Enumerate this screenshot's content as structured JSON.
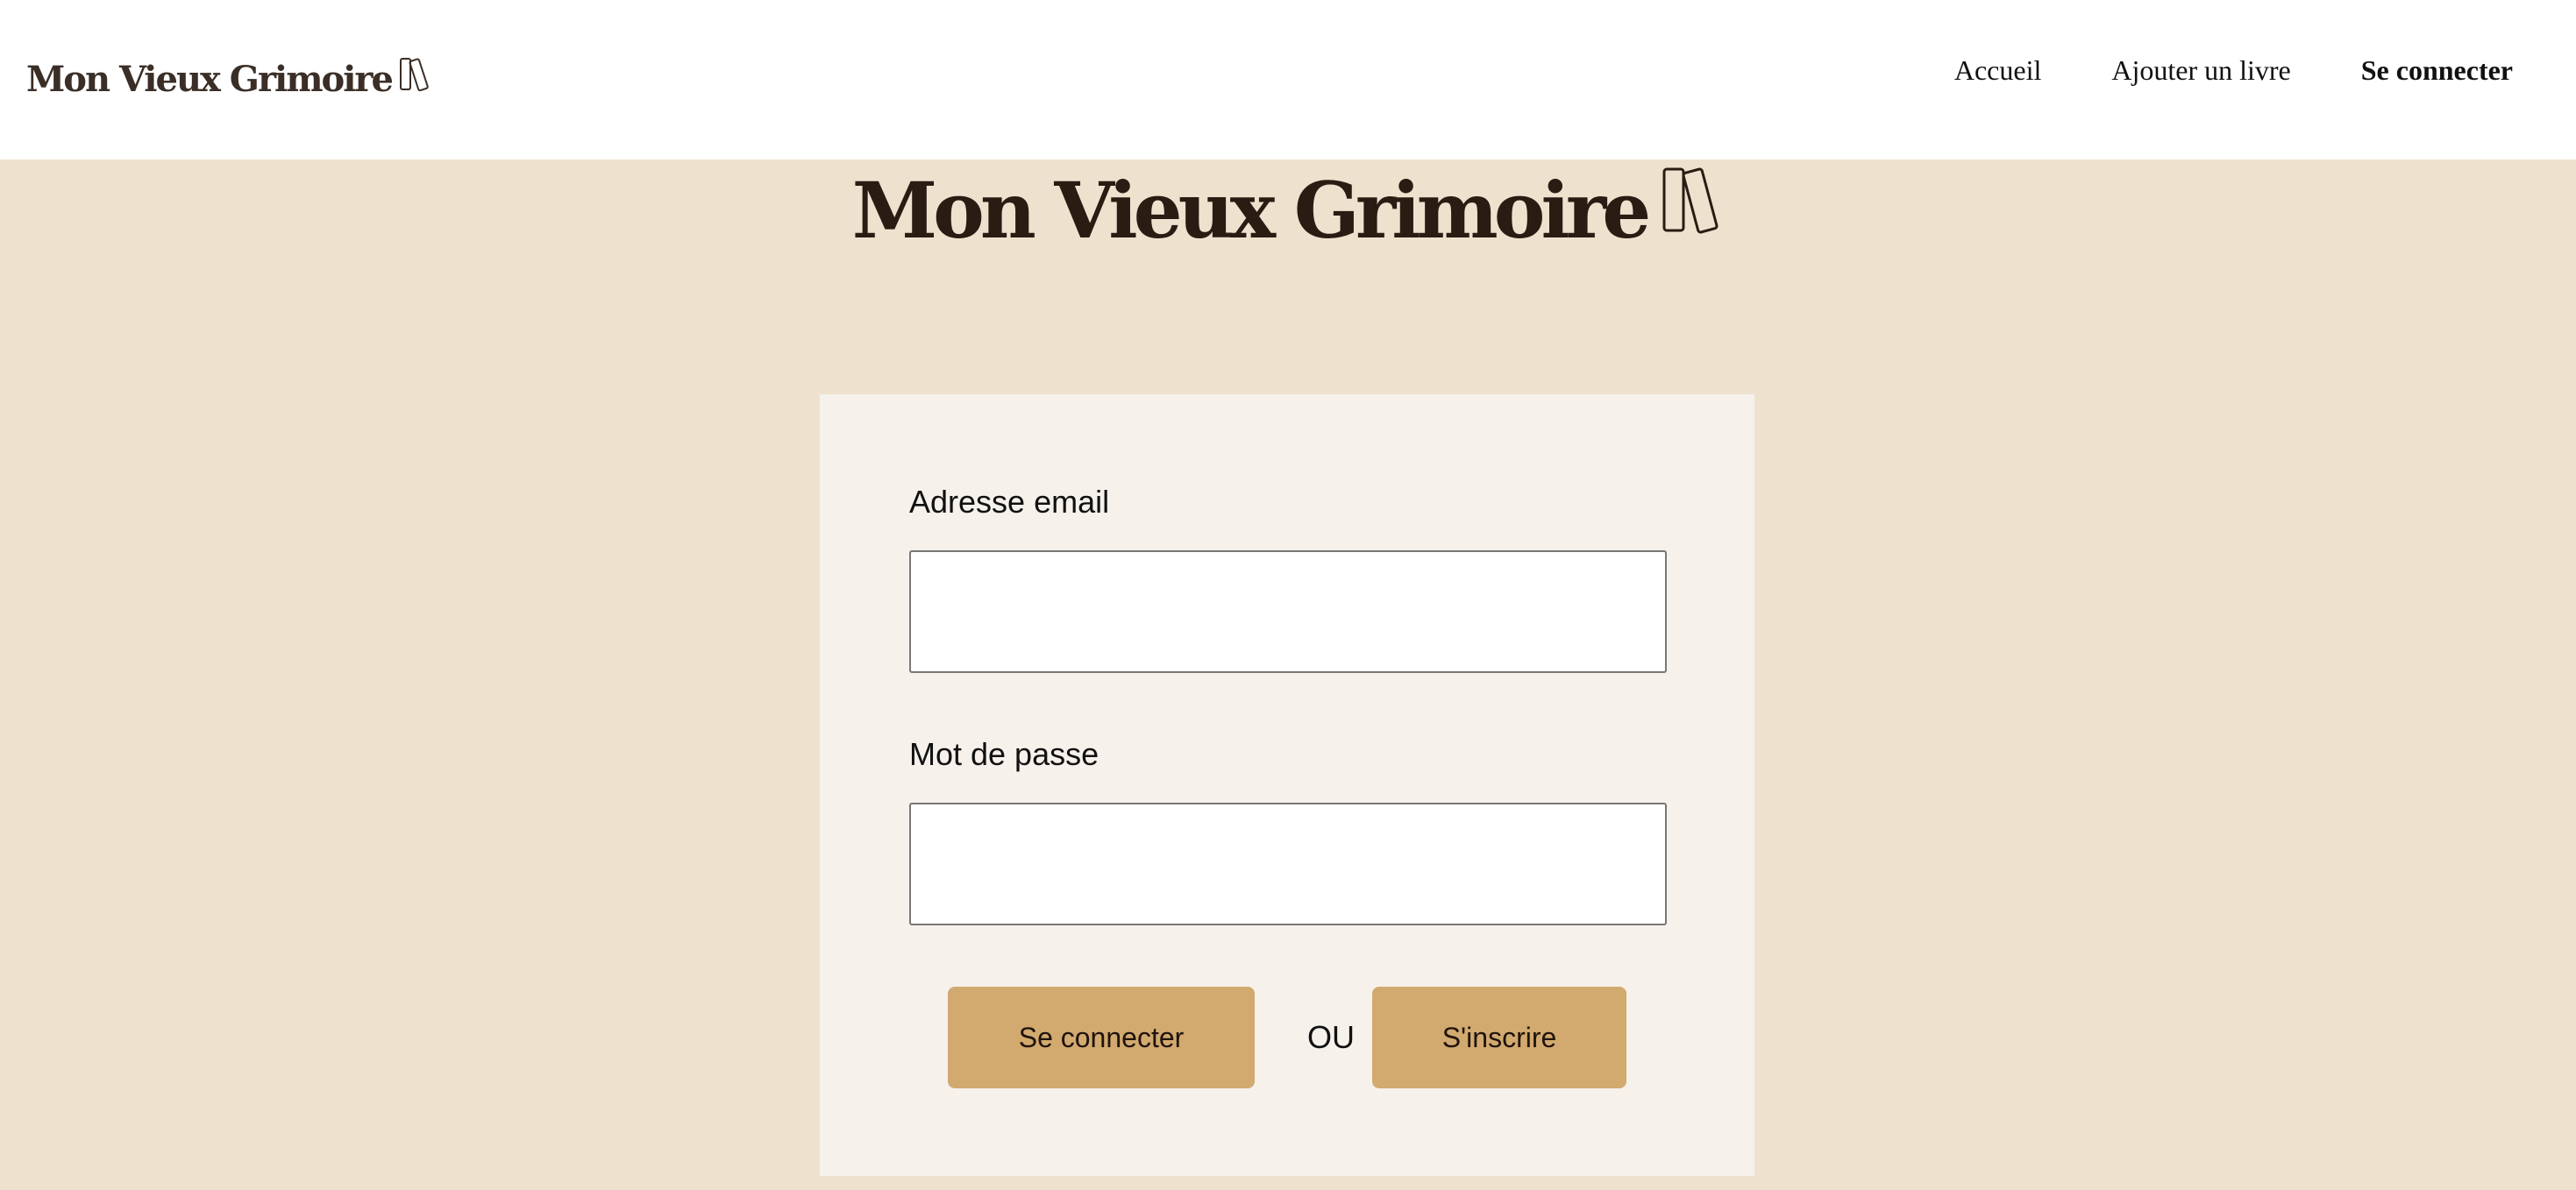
{
  "header": {
    "brand": "Mon Vieux Grimoire",
    "brand_icon": "books-icon",
    "nav": [
      {
        "label": "Accueil",
        "active": false
      },
      {
        "label": "Ajouter un livre",
        "active": false
      },
      {
        "label": "Se connecter",
        "active": true
      }
    ]
  },
  "hero": {
    "title": "Mon Vieux Grimoire",
    "icon": "books-icon"
  },
  "login_form": {
    "email_label": "Adresse email",
    "email_value": "",
    "password_label": "Mot de passe",
    "password_value": "",
    "login_button": "Se connecter",
    "separator": "OU",
    "signup_button": "S'inscrire"
  },
  "colors": {
    "page_background": "#EEE2CF",
    "header_background": "#FFFFFF",
    "card_background": "#F6F1EB",
    "button_background": "#D2A96F",
    "title_color": "#2A1C12"
  }
}
